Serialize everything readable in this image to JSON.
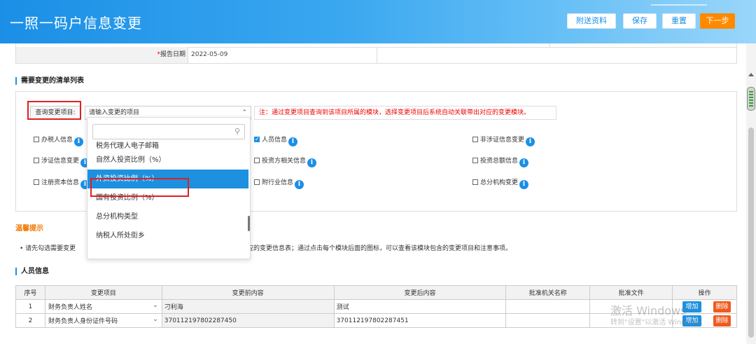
{
  "header": {
    "title": "一照一码户信息变更",
    "buttons": {
      "attach": "附送资料",
      "save": "保存",
      "reset": "重置",
      "next": "下一步"
    }
  },
  "report": {
    "required_mark": "*",
    "label": "报告日期",
    "value": "2022-05-09"
  },
  "change_list": {
    "section_title": "需要变更的清单列表",
    "query_label": "查询变更项目:",
    "query_placeholder": "请输入变更的项目",
    "note": "注：通过变更项目查询到该项目所属的模块，选择变更项目后系统自动关联带出对应的变更模块。",
    "checkboxes": [
      {
        "label": "办税人信息",
        "checked": false
      },
      {
        "label": "人员信息",
        "checked": true
      },
      {
        "label": "非涉证信息变更",
        "checked": false
      },
      {
        "label": "涉证信息变更",
        "checked": false
      },
      {
        "label": "投资方相关信息",
        "checked": false
      },
      {
        "label": "投资总额信息",
        "checked": false
      },
      {
        "label": "注册资本信息",
        "checked": false
      },
      {
        "label": "附行业信息",
        "checked": false
      },
      {
        "label": "总分机构变更",
        "checked": false
      }
    ],
    "info_glyph": "i",
    "dropdown": {
      "items": [
        "税务代理人电子邮箱",
        "自然人投资比例（%）",
        "外资投资比例（%）",
        "国有投资比例（%）",
        "总分机构类型",
        "纳税人所处街乡"
      ],
      "selected_index": 2
    }
  },
  "tips": {
    "title": "温馨提示",
    "text_a": "• 请先勾选需要变更",
    "text_b": "对应的变更信息表；通过点击每个模块后面的图标，可以查看该模块包含的变更项目和注意事项。"
  },
  "person": {
    "section_title": "人员信息",
    "columns": [
      "序号",
      "变更项目",
      "变更前内容",
      "变更后内容",
      "批准机关名称",
      "批准文件",
      "操作"
    ],
    "rows": [
      {
        "no": "1",
        "item": "财务负责人姓名",
        "before": "刁利海",
        "after": "测试"
      },
      {
        "no": "2",
        "item": "财务负责人身份证件号码",
        "before": "370112197802287450",
        "after": "370112197802287451"
      }
    ],
    "add_label": "增加",
    "delete_label": "删除"
  },
  "watermark": {
    "line1": "激活 Windows",
    "line2": "转到\"设置\"以激活 Windows。"
  }
}
